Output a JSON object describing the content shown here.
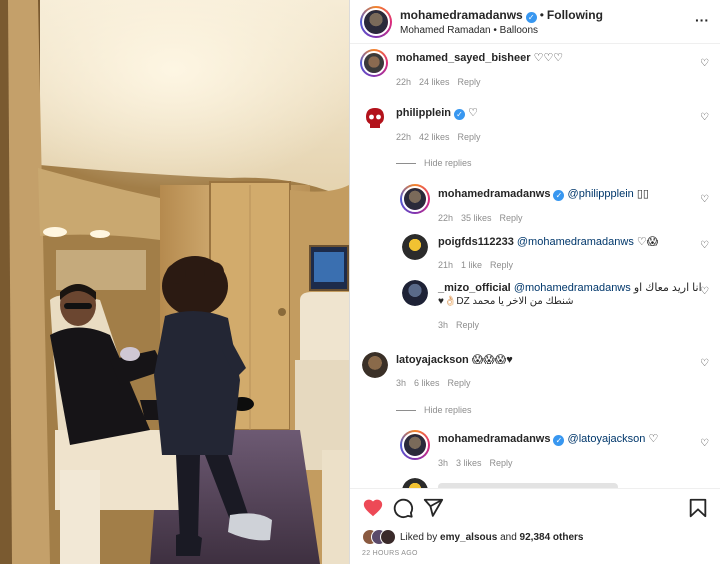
{
  "header": {
    "username": "mohamedramadanws",
    "verified_mark": "✓",
    "separator": "•",
    "follow_status": "Following",
    "subtitle": "Mohamed Ramadan • Balloons",
    "more_icon": "more-horizontal-icon"
  },
  "comments": [
    {
      "username": "mohamed_sayed_bisheer",
      "text": "♡♡♡",
      "time": "22h",
      "likes": "24 likes",
      "reply": "Reply"
    },
    {
      "username": "philipplein",
      "verified": true,
      "text": "♡",
      "time": "22h",
      "likes": "42 likes",
      "reply": "Reply"
    }
  ],
  "hide_replies_1": "Hide replies",
  "replies_1": [
    {
      "username": "mohamedramadanws",
      "verified": true,
      "mention": "@philippplein",
      "text": "▯▯",
      "time": "22h",
      "likes": "35 likes",
      "reply": "Reply"
    },
    {
      "username": "poigfds112233",
      "mention": "@mohamedramadanws",
      "text": "♡😱",
      "time": "21h",
      "likes": "1 like",
      "reply": "Reply"
    },
    {
      "username": "_mizo_official",
      "mention": "@mohamedramadanws",
      "text_rtl_1": "انا اريد معاك او",
      "text_rtl_2": "شنطك من الاخر يا محمد DZ👌🏻♥",
      "time": "3h",
      "reply": "Reply"
    }
  ],
  "comment_3": {
    "username": "latoyajackson",
    "text": "😱😱😱♥",
    "time": "3h",
    "likes": "6 likes",
    "reply": "Reply"
  },
  "hide_replies_2": "Hide replies",
  "replies_2": [
    {
      "username": "mohamedramadanws",
      "verified": true,
      "mention": "@latoyajackson",
      "text": "♡",
      "time": "3h",
      "likes": "3 likes",
      "reply": "Reply"
    }
  ],
  "actions": {
    "like_icon": "heart-filled-icon",
    "comment_icon": "comment-icon",
    "share_icon": "share-icon",
    "save_icon": "bookmark-icon",
    "liked_by_prefix": "Liked by",
    "liked_by_user": "emy_alsous",
    "liked_by_and": "and",
    "liked_by_others": "92,384 others",
    "time_ago": "22 HOURS AGO"
  },
  "colors": {
    "like_red": "#ed4956",
    "verified_blue": "#3897f0",
    "mention_blue": "#00376b",
    "muted_gray": "#8e8e8e"
  }
}
